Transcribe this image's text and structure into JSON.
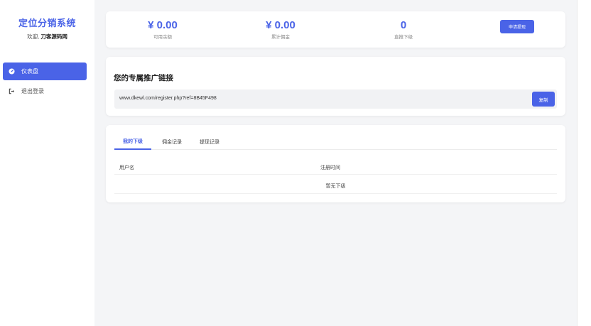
{
  "brand": {
    "title": "定位分销系统",
    "welcome_prefix": "欢迎, ",
    "username": "刀客源码网"
  },
  "nav": {
    "items": [
      {
        "label": "仪表盘",
        "icon": "dashboard-icon",
        "active": true
      },
      {
        "label": "退出登录",
        "icon": "logout-icon",
        "active": false
      }
    ]
  },
  "stats": {
    "available_balance": {
      "value": "¥ 0.00",
      "label": "可用余额"
    },
    "total_commission": {
      "value": "¥ 0.00",
      "label": "累计佣金"
    },
    "direct_referrals": {
      "value": "0",
      "label": "直推下级"
    },
    "withdraw_label": "申请提现"
  },
  "promo": {
    "title": "您的专属推广链接",
    "link": "www.dkewl.com/register.php?ref=8B45F498",
    "copy_label": "复制"
  },
  "records": {
    "tabs": [
      {
        "label": "我的下级",
        "active": true
      },
      {
        "label": "佣金记录",
        "active": false
      },
      {
        "label": "提现记录",
        "active": false
      }
    ],
    "columns": [
      "用户名",
      "注册时间"
    ],
    "empty_text": "暂无下级"
  },
  "colors": {
    "accent": "#4a63e7",
    "background": "#f4f5f7"
  }
}
